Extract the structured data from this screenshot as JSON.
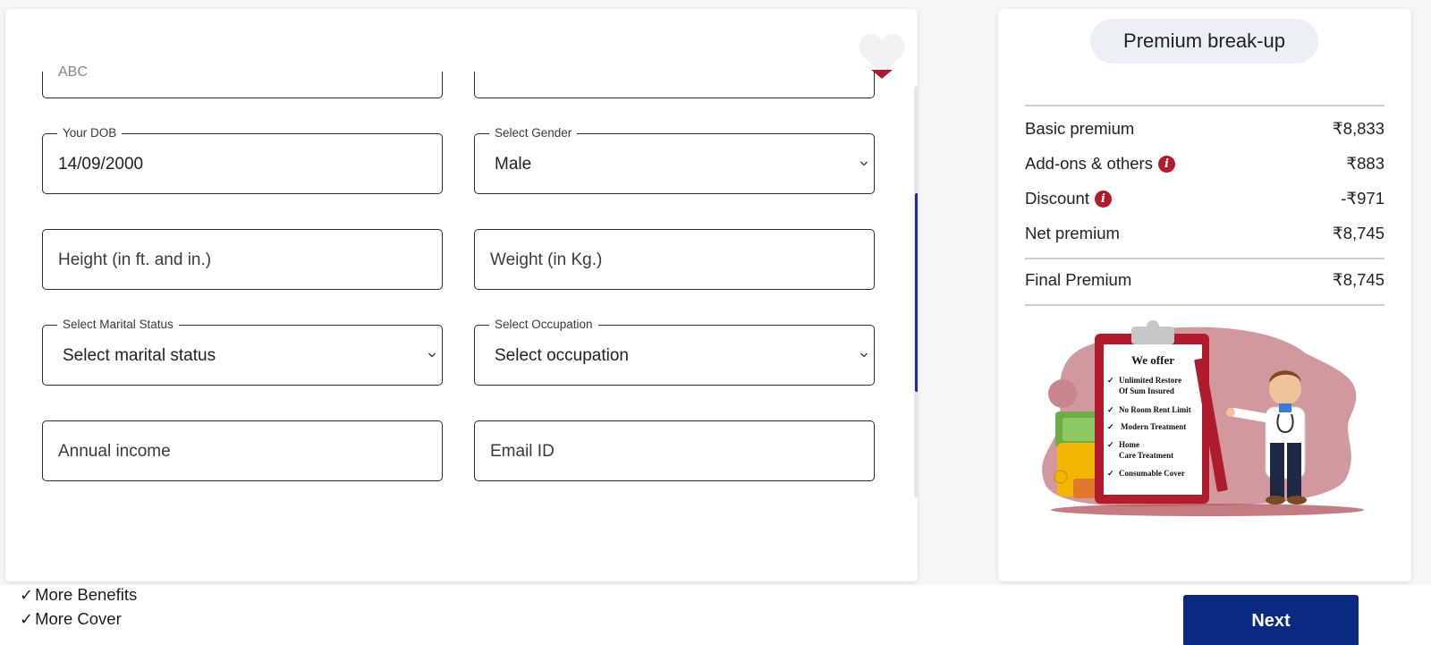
{
  "form": {
    "top_left_partial_value": "ABC",
    "dob": {
      "legend": "Your DOB",
      "value": "14/09/2000"
    },
    "gender": {
      "legend": "Select Gender",
      "value": "Male"
    },
    "height": {
      "placeholder": "Height (in ft. and in.)"
    },
    "weight": {
      "placeholder": "Weight (in Kg.)"
    },
    "marital": {
      "legend": "Select Marital Status",
      "value": "Select marital status"
    },
    "occupation": {
      "legend": "Select Occupation",
      "value": "Select occupation"
    },
    "income": {
      "placeholder": "Annual income"
    },
    "email": {
      "placeholder": "Email ID"
    }
  },
  "premium": {
    "title": "Premium break-up",
    "rows": [
      {
        "label": "Basic premium",
        "value": "₹8,833"
      },
      {
        "label": "Add-ons & others",
        "value": "₹883"
      },
      {
        "label": "Discount",
        "value": "-₹971"
      },
      {
        "label": "Net premium",
        "value": "₹8,745"
      }
    ],
    "final": {
      "label": "Final Premium",
      "value": "₹8,745"
    }
  },
  "illustration": {
    "heading": "We offer",
    "items": [
      "Unlimited Restore",
      "Of Sum Insured",
      "No Room Rent Limit",
      "Modern Treatment",
      "Home",
      "Care Treatment",
      "Consumable Cover"
    ]
  },
  "footer": {
    "benefits": [
      "More Benefits",
      "More Cover"
    ],
    "next_label": "Next"
  },
  "colors": {
    "primary": "#0a2a82",
    "accent_red": "#b01c2e",
    "scroll_thumb": "#1c2c8f"
  }
}
